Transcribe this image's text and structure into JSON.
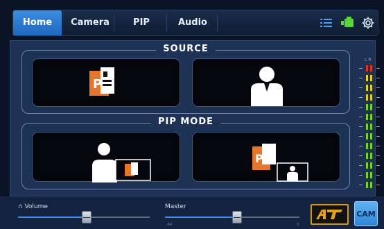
{
  "tabs": [
    {
      "label": "Home",
      "active": true
    },
    {
      "label": "Camera",
      "active": false
    },
    {
      "label": "PIP",
      "active": false
    },
    {
      "label": "Audio",
      "active": false
    }
  ],
  "top_icons": [
    "list-icon",
    "camera-icon",
    "gear-icon"
  ],
  "source": {
    "title": "SOURCE",
    "tiles": [
      {
        "name": "source-presentation",
        "icon": "powerpoint-icon"
      },
      {
        "name": "source-presenter",
        "icon": "presenter-icon"
      }
    ]
  },
  "pip_mode": {
    "title": "PIP MODE",
    "tiles": [
      {
        "name": "pip-presenter-with-slides",
        "icon": "presenter-pip-slides-icon"
      },
      {
        "name": "pip-slides-with-presenter",
        "icon": "slides-pip-presenter-icon"
      }
    ]
  },
  "meter": {
    "label": "L R"
  },
  "bottom": {
    "volume": {
      "label": "Volume",
      "icon": "headphones-icon",
      "level": 0.45
    },
    "master": {
      "label": "Master",
      "level": 0.5,
      "tick_min": "-64",
      "tick_max": "0"
    },
    "at_label": "AT",
    "cam_label": "CAM"
  },
  "colors": {
    "accent": "#2f7bd6",
    "powerpoint": "#e8762a",
    "meter_green": "#7bd321",
    "meter_yellow": "#e8d11e",
    "meter_red": "#e8321e",
    "at_border": "#d39b17"
  }
}
